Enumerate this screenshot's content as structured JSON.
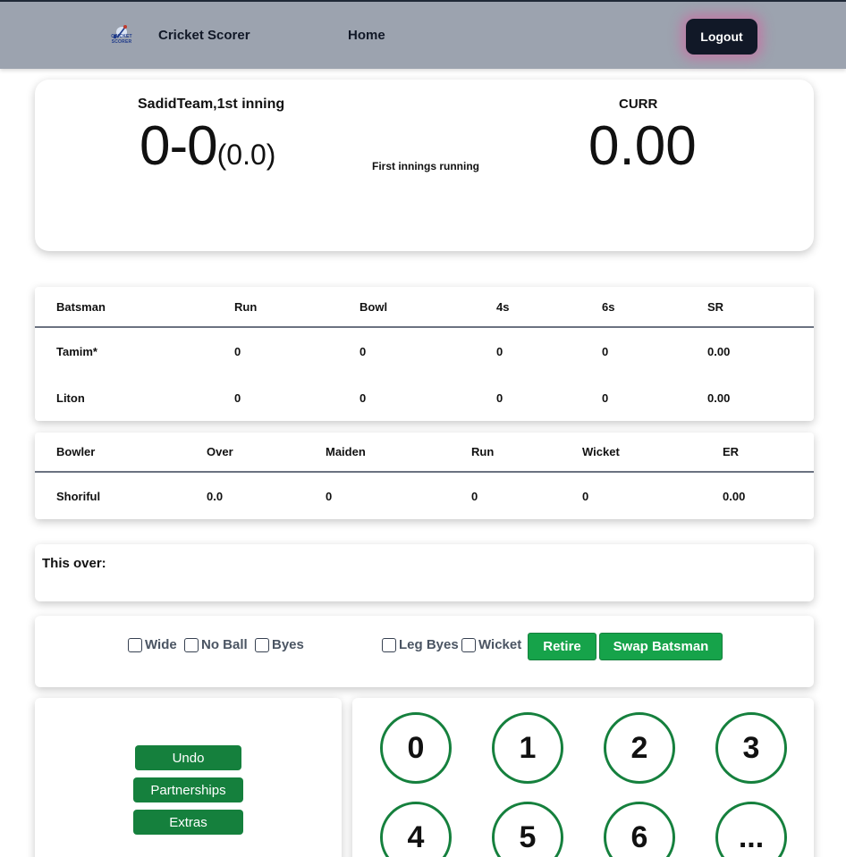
{
  "navbar": {
    "logo_text": "CRICKET SCORER",
    "brand": "Cricket Scorer",
    "home": "Home",
    "logout": "Logout"
  },
  "scoreboard": {
    "team_inning": "SadidTeam,1st inning",
    "score": "0-0",
    "overs": "(0.0)",
    "status": "First innings running",
    "curr_label": "CURR",
    "curr_value": "0.00"
  },
  "batting": {
    "headers": [
      "Batsman",
      "Run",
      "Bowl",
      "4s",
      "6s",
      "SR"
    ],
    "rows": [
      [
        "Tamim*",
        "0",
        "0",
        "0",
        "0",
        "0.00"
      ],
      [
        "Liton",
        "0",
        "0",
        "0",
        "0",
        "0.00"
      ]
    ]
  },
  "bowling": {
    "headers": [
      "Bowler",
      "Over",
      "Maiden",
      "Run",
      "Wicket",
      "ER"
    ],
    "rows": [
      [
        "Shoriful",
        "0.0",
        "0",
        "0",
        "0",
        "0.00"
      ]
    ]
  },
  "this_over": {
    "label": "This over:"
  },
  "extras": {
    "wide": "Wide",
    "no_ball": "No Ball",
    "byes": "Byes",
    "leg_byes": "Leg Byes",
    "wicket": "Wicket",
    "retire": "Retire",
    "swap": "Swap Batsman"
  },
  "actions": {
    "undo": "Undo",
    "partnerships": "Partnerships",
    "extras": "Extras"
  },
  "runs": [
    "0",
    "1",
    "2",
    "3",
    "4",
    "5",
    "6",
    "..."
  ],
  "colors": {
    "navbar": "#9ca3af",
    "accent_green": "#16a34a",
    "dark_green": "#15803d",
    "logout_bg": "#111827"
  }
}
